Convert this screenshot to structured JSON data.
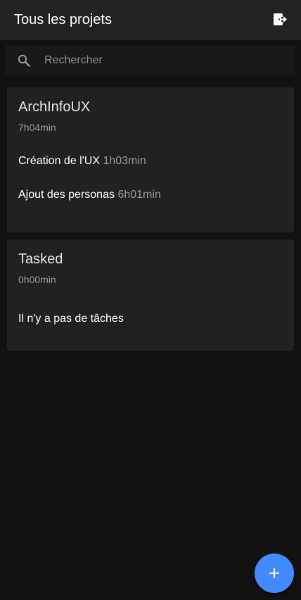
{
  "header": {
    "title": "Tous les projets",
    "logout_icon": "logout-icon"
  },
  "search": {
    "placeholder": "Rechercher",
    "value": "",
    "icon": "search-icon"
  },
  "projects": [
    {
      "name": "ArchInfoUX",
      "duration": "7h04min",
      "tasks": [
        {
          "label": "Création de l'UX",
          "duration": "1h03min"
        },
        {
          "label": "Ajout des personas",
          "duration": "6h01min"
        }
      ]
    },
    {
      "name": "Tasked",
      "duration": "0h00min",
      "empty_message": "Il n'y a pas de tâches"
    }
  ],
  "fab": {
    "icon": "plus-icon",
    "color": "#448aff"
  },
  "colors": {
    "background": "#121212",
    "appbar": "#222222",
    "card": "#212121",
    "accent": "#448aff",
    "secondary_text": "#9a9a9a"
  }
}
